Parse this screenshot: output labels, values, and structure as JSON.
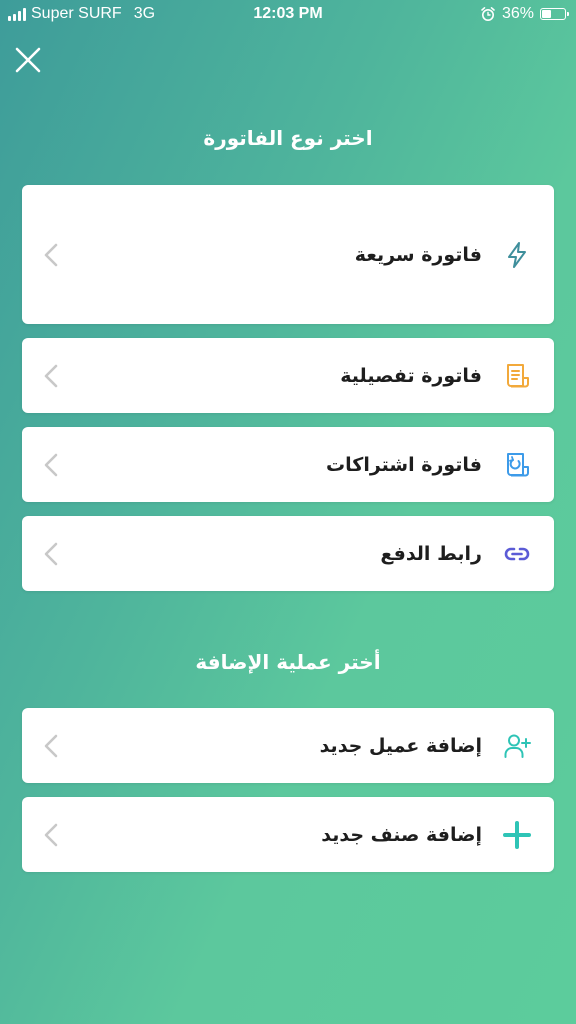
{
  "status_bar": {
    "carrier": "Super SURF",
    "network": "3G",
    "time": "12:03 PM",
    "battery_percent": "36%",
    "battery_level": 0.36
  },
  "invoice_section": {
    "title": "اختر نوع الفاتورة",
    "items": [
      {
        "label": "فاتورة سريعة",
        "icon": "lightning-icon",
        "icon_color": "#3f8f9c"
      },
      {
        "label": "فاتورة تفصيلية",
        "icon": "receipt-icon",
        "icon_color": "#f2a93b"
      },
      {
        "label": "فاتورة اشتراكات",
        "icon": "subscription-invoice-icon",
        "icon_color": "#3d9be9"
      },
      {
        "label": "رابط الدفع",
        "icon": "link-icon",
        "icon_color": "#5b5bd6"
      }
    ]
  },
  "add_section": {
    "title": "أختر عملية الإضافة",
    "items": [
      {
        "label": "إضافة عميل جديد",
        "icon": "add-user-icon",
        "icon_color": "#2ec4b6"
      },
      {
        "label": "إضافة صنف جديد",
        "icon": "plus-icon",
        "icon_color": "#2ec4b6"
      }
    ]
  },
  "colors": {
    "gradient_start": "#3e9c9a",
    "gradient_end": "#5ccc9c",
    "chevron": "#c8c8c8"
  }
}
